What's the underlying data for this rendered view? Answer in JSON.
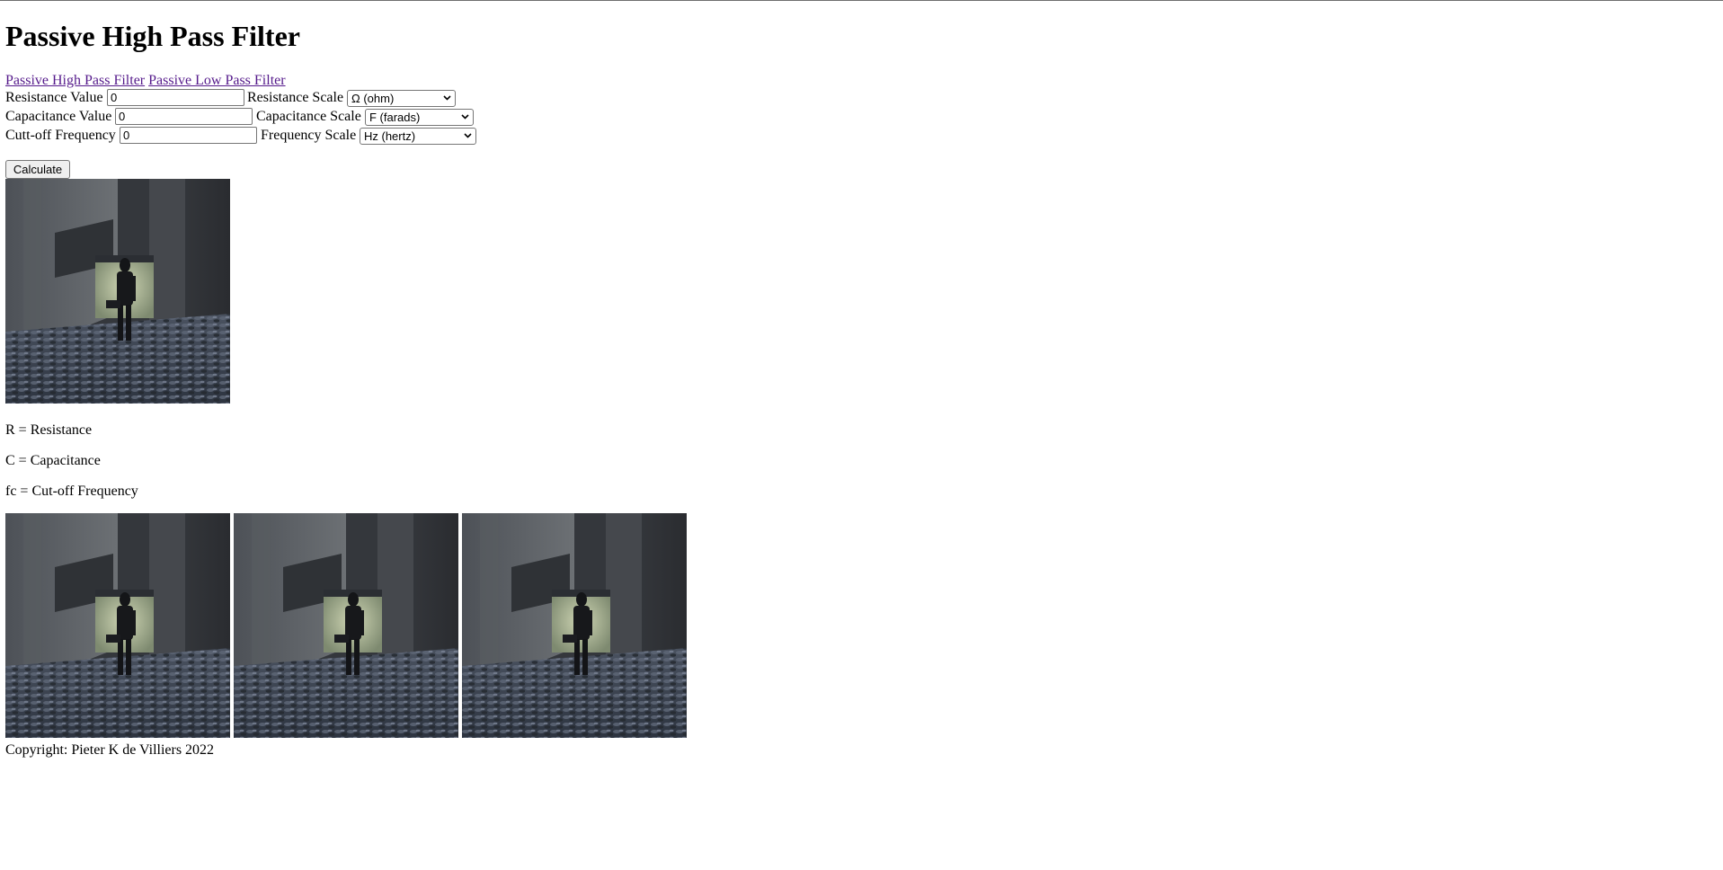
{
  "page": {
    "title": "Passive High Pass Filter"
  },
  "nav": {
    "links": [
      {
        "label": "Passive High Pass Filter"
      },
      {
        "label": "Passive Low Pass Filter"
      }
    ]
  },
  "form": {
    "resistance": {
      "label": "Resistance Value",
      "value": "0",
      "scale_label": "Resistance Scale",
      "scale_selected": "Ω (ohm)"
    },
    "capacitance": {
      "label": "Capacitance Value",
      "value": "0",
      "scale_label": "Capacitance Scale",
      "scale_selected": "F (farads)"
    },
    "frequency": {
      "label": "Cutt-off Frequency",
      "value": "0",
      "scale_label": "Frequency Scale",
      "scale_selected": "Hz (hertz)"
    },
    "calculate_label": "Calculate"
  },
  "legend": {
    "items": [
      {
        "text": "R = Resistance"
      },
      {
        "text": "C = Capacitance"
      },
      {
        "text": "fc = Cut-off Frequency"
      }
    ]
  },
  "images": {
    "description_icon": "photo-of-figure-in-corridor"
  },
  "footer": {
    "copyright": "Copyright: Pieter K de Villiers 2022"
  },
  "colors": {
    "link_visited": "#551a8b",
    "button_bg": "#efefef",
    "border": "#767676"
  }
}
